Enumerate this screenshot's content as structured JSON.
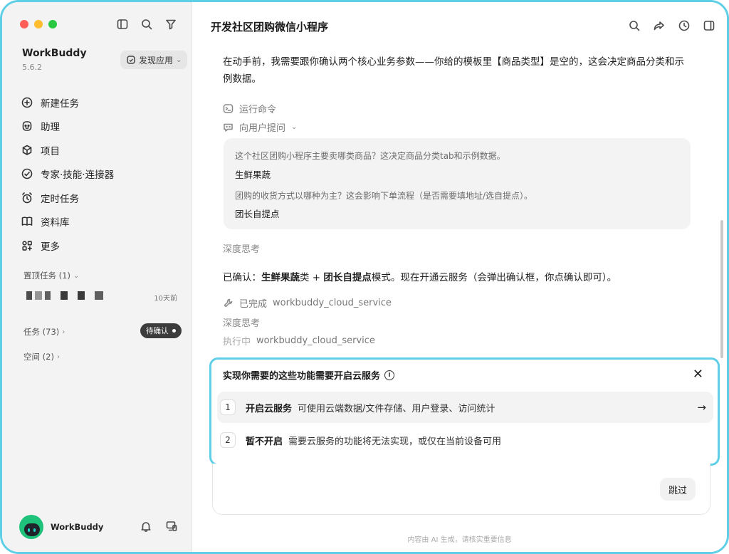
{
  "window": {
    "traffic_lights": [
      "#ff5f57",
      "#febc2e",
      "#28c840"
    ],
    "accent": "#5ecfe6"
  },
  "sidebar": {
    "top_icons": [
      "sidebar-toggle-icon",
      "search-icon",
      "filter-icon"
    ],
    "app_name": "WorkBuddy",
    "app_version": "5.6.2",
    "discover_label": "发现应用",
    "nav": [
      {
        "label": "新建任务",
        "icon": "plus-circle-icon"
      },
      {
        "label": "助理",
        "icon": "assistant-icon"
      },
      {
        "label": "项目",
        "icon": "project-icon"
      },
      {
        "label": "专家·技能·连接器",
        "icon": "expert-icon"
      },
      {
        "label": "定时任务",
        "icon": "alarm-clock-icon"
      },
      {
        "label": "资料库",
        "icon": "book-icon"
      },
      {
        "label": "更多",
        "icon": "grid-icon"
      }
    ],
    "pinned_label": "置顶任务 (1)",
    "pinned_time": "10天前",
    "tasks_label": "任务 (73)",
    "pending_badge": "待确认",
    "spaces_label": "空间 (2)",
    "user_name": "WorkBuddy"
  },
  "main": {
    "title": "开发社区团购微信小程序",
    "top_icons": [
      "search-icon",
      "share-icon",
      "history-icon",
      "panel-icon"
    ],
    "intro_text": "在动手前，我需要跟你确认两个核心业务参数——你给的模板里【商品类型】是空的，这会决定商品分类和示例数据。",
    "step_run_command": "运行命令",
    "step_ask_user": "向用户提问",
    "qa": [
      {
        "q": "这个社区团购小程序主要卖哪类商品？这决定商品分类tab和示例数据。",
        "a": "生鲜果蔬"
      },
      {
        "q": "团购的收货方式以哪种为主？这会影响下单流程（是否需要填地址/选自提点）。",
        "a": "团长自提点"
      }
    ],
    "thinking_1": "深度思考",
    "confirm_prefix": "已确认：",
    "confirm_b1": "生鲜果蔬",
    "confirm_mid": "类 + ",
    "confirm_b2": "团长自提点",
    "confirm_suffix": "模式。现在开通云服务（会弹出确认框，你点确认即可）。",
    "done_label": "已完成",
    "done_tool": "workbuddy_cloud_service",
    "thinking_2": "深度思考",
    "running_label": "执行中",
    "running_tool": "workbuddy_cloud_service"
  },
  "dialog": {
    "title": "实现你需要的这些功能需要开启云服务",
    "options": [
      {
        "num": "1",
        "title": "开启云服务",
        "desc": "可使用云端数据/文件存储、用户登录、访问统计"
      },
      {
        "num": "2",
        "title": "暂不开启",
        "desc": "需要云服务的功能将无法实现，或仅在当前设备可用"
      }
    ]
  },
  "input": {
    "skip_label": "跳过"
  },
  "footer_note": "内容由 AI 生成，请核实重要信息"
}
